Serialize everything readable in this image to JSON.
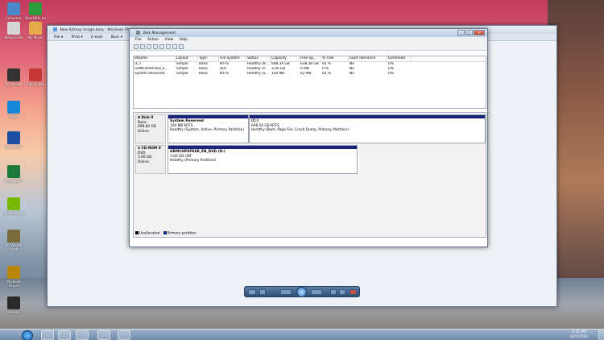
{
  "desktop": {
    "icons": [
      {
        "label": "Computer",
        "color": "#4a88c9"
      },
      {
        "label": "New Bitm Im bmp",
        "color": "#2e9b3a"
      },
      {
        "label": "Recycle Bin",
        "color": "#d5d5d5"
      },
      {
        "label": "My Music",
        "color": "#e6a94a"
      },
      {
        "label": "PC Wizard",
        "color": "#333333"
      },
      {
        "label": "EVE Online",
        "color": "#c83737"
      },
      {
        "label": "Skype",
        "color": "#1a88d8"
      },
      {
        "label": "Word 2007",
        "color": "#1c4f9f"
      },
      {
        "label": "Excel 2007",
        "color": "#1d7a3a"
      },
      {
        "label": "nvidia control",
        "color": "#76b900"
      },
      {
        "label": "PC Wizard 2008",
        "color": "#7a6b3a"
      },
      {
        "label": "Windows Repair",
        "color": "#b8860b"
      },
      {
        "label": "Steam",
        "color": "#2a2a2a"
      }
    ]
  },
  "photo_viewer": {
    "title": "New Bitmap Image.bmp - Windows Photo V",
    "menu": [
      "File ▾",
      "Print ▾",
      "E-mail",
      "Burn ▾"
    ]
  },
  "disk_management": {
    "title": "Disk Management",
    "menu": [
      "File",
      "Action",
      "View",
      "Help"
    ],
    "columns": [
      "Volume",
      "Layout",
      "Type",
      "File System",
      "Status",
      "Capacity",
      "Free Sp...",
      "% Free",
      "Fault Tolerance",
      "Overhead"
    ],
    "volumes": [
      [
        "(C:)",
        "Simple",
        "Basic",
        "NTFS",
        "Healthy (B...",
        "698.34 GB",
        "638.38 GB",
        "92 %",
        "No",
        "0%"
      ],
      [
        "GRMCHPXFRER_E...",
        "Simple",
        "Basic",
        "UDF",
        "Healthy (P...",
        "3.00 GB",
        "0 MB",
        "0 %",
        "No",
        "0%"
      ],
      [
        "System Reserved",
        "Simple",
        "Basic",
        "NTFS",
        "Healthy (S...",
        "100 MB",
        "62 MB",
        "62 %",
        "No",
        "0%"
      ]
    ],
    "disk0": {
      "name": "Disk 0",
      "type": "Basic",
      "size": "698.64 GB",
      "state": "Online",
      "p1_name": "System Reserved",
      "p1_size": "100 MB NTFS",
      "p1_status": "Healthy (System, Active, Primary Partition)",
      "p2_name": "(C:)",
      "p2_size": "698.54 GB NTFS",
      "p2_status": "Healthy (Boot, Page File, Crash Dump, Primary Partition)"
    },
    "cdrom0": {
      "name": "CD-ROM 0",
      "type": "DVD",
      "size": "3.00 GB",
      "state": "Online",
      "p_name": "GRMCHPXFRER_EN_DVD (D:)",
      "p_size": "3.00 GB UDF",
      "p_status": "Healthy (Primary Partition)"
    },
    "legend": [
      {
        "label": "Unallocated",
        "color": "#000000"
      },
      {
        "label": "Primary partition",
        "color": "#17227d"
      }
    ]
  },
  "taskbar": {
    "time": "2:41 AM",
    "date": "6/25/2010"
  }
}
